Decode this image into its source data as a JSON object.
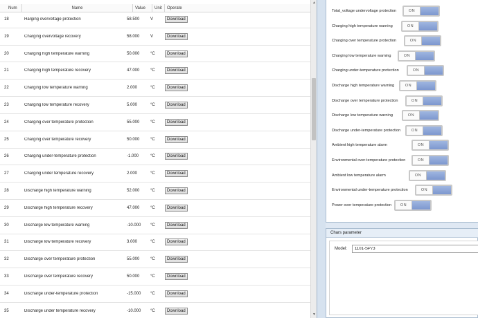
{
  "table": {
    "headers": {
      "num": "Num",
      "name": "Name",
      "value": "Value",
      "unit": "Unit",
      "operate": "Operate"
    },
    "rows": [
      {
        "num": "18",
        "name": "Harging overvoltage protection",
        "value": "58.500",
        "unit": "V",
        "operate": "Download"
      },
      {
        "num": "19",
        "name": "Charging overvoltage recovery",
        "value": "58.000",
        "unit": "V",
        "operate": "Download"
      },
      {
        "num": "20",
        "name": "Charging high temperature warning",
        "value": "50.000",
        "unit": "°C",
        "operate": "Download"
      },
      {
        "num": "21",
        "name": "Charging high temperature recovery",
        "value": "47.000",
        "unit": "°C",
        "operate": "Download"
      },
      {
        "num": "22",
        "name": "Charging low temperature warning",
        "value": "2.000",
        "unit": "°C",
        "operate": "Download"
      },
      {
        "num": "23",
        "name": "Charging low temperature recovery",
        "value": "5.000",
        "unit": "°C",
        "operate": "Download"
      },
      {
        "num": "24",
        "name": "Charging over temperature protection",
        "value": "55.000",
        "unit": "°C",
        "operate": "Download"
      },
      {
        "num": "25",
        "name": "Charging over temperature recovery",
        "value": "50.000",
        "unit": "°C",
        "operate": "Download"
      },
      {
        "num": "26",
        "name": "Charging under-temperature protection",
        "value": "-1.000",
        "unit": "°C",
        "operate": "Download"
      },
      {
        "num": "27",
        "name": "Charging under temperature recovery",
        "value": "2.000",
        "unit": "°C",
        "operate": "Download"
      },
      {
        "num": "28",
        "name": "Discharge high temperature warning",
        "value": "52.000",
        "unit": "°C",
        "operate": "Download"
      },
      {
        "num": "29",
        "name": "Discharge high temperature recovery",
        "value": "47.000",
        "unit": "°C",
        "operate": "Download"
      },
      {
        "num": "30",
        "name": "Discharge low temperature warning",
        "value": "-10.000",
        "unit": "°C",
        "operate": "Download"
      },
      {
        "num": "31",
        "name": "Discharge low temperature recovery",
        "value": "3.000",
        "unit": "°C",
        "operate": "Download"
      },
      {
        "num": "32",
        "name": "Discharge over temperature protection",
        "value": "55.000",
        "unit": "°C",
        "operate": "Download"
      },
      {
        "num": "33",
        "name": "Discharge over temperature recovery",
        "value": "50.000",
        "unit": "°C",
        "operate": "Download"
      },
      {
        "num": "34",
        "name": "Discharge under-temperature protection",
        "value": "-15.000",
        "unit": "°C",
        "operate": "Download"
      },
      {
        "num": "35",
        "name": "Discharge under temperature recovery",
        "value": "-10.000",
        "unit": "°C",
        "operate": "Download"
      }
    ]
  },
  "alarms": [
    {
      "label": "Total_voltage undervoltage protection",
      "state": "ON"
    },
    {
      "label": "Charging high temperature warning",
      "state": "ON"
    },
    {
      "label": "Charging over temperature protection",
      "state": "ON"
    },
    {
      "label": "Charging low temperature warning",
      "state": "ON"
    },
    {
      "label": "Charging under-temperature protection",
      "state": "ON"
    },
    {
      "label": "Discharge high temperature warning",
      "state": "ON"
    },
    {
      "label": "Discharge over temperature protection",
      "state": "ON"
    },
    {
      "label": "Discharge low temperature warning",
      "state": "ON"
    },
    {
      "label": "Discharge under-temperature protection",
      "state": "ON"
    },
    {
      "label": "Ambient high temperature alarm",
      "state": "ON"
    },
    {
      "label": "Environmental over-temperature protection",
      "state": "ON"
    },
    {
      "label": "Ambient low temperature alarm",
      "state": "ON"
    },
    {
      "label": "Environmental under-temperature protection",
      "state": "ON"
    },
    {
      "label": "Power over temperature protection",
      "state": "ON"
    }
  ],
  "chars": {
    "title": "Chars parameter",
    "model_label": "Model:",
    "model_value": "1101-SP73"
  },
  "icons": {
    "scroll_up": "scroll-up-arrow-icon",
    "scroll_down": "scroll-down-arrow-icon"
  },
  "colors": {
    "toggle_on": "#8aa4d8",
    "panel_bg": "#dfe8f3"
  }
}
